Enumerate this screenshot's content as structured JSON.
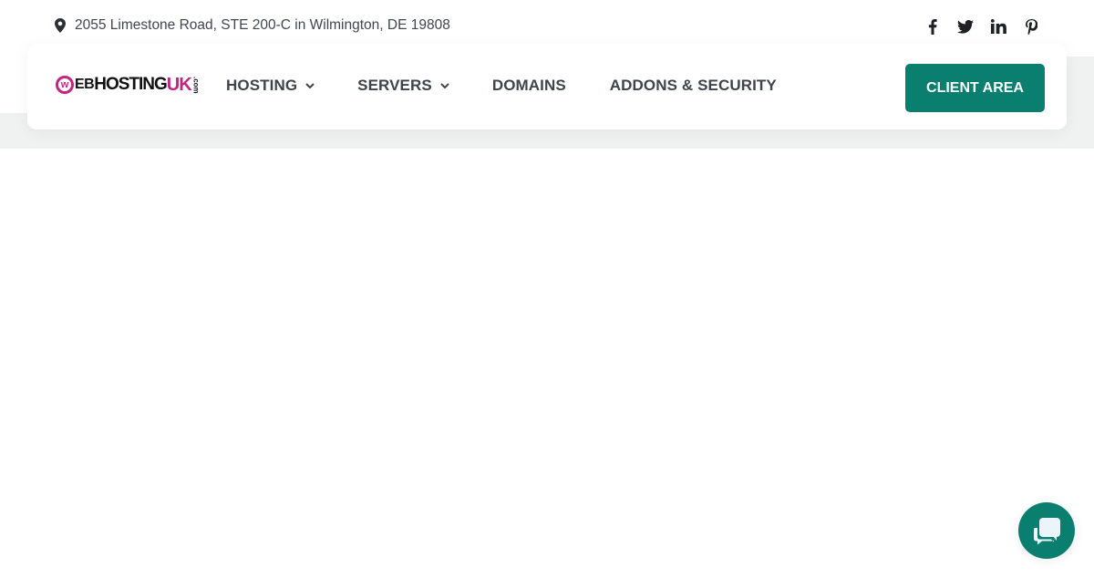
{
  "topbar": {
    "address_icon": "map-pin-icon",
    "address": "2055 Limestone Road, STE 200-C in Wilmington, DE 19808",
    "socials": [
      {
        "name": "facebook",
        "icon": "facebook-icon"
      },
      {
        "name": "twitter",
        "icon": "twitter-icon"
      },
      {
        "name": "linkedin",
        "icon": "linkedin-icon"
      },
      {
        "name": "pinterest",
        "icon": "pinterest-icon"
      }
    ]
  },
  "logo": {
    "w": "w",
    "eb": "EB",
    "hosting": "HOSTING",
    "uk": "UK",
    "com": ".com"
  },
  "nav": {
    "items": [
      {
        "label": "HOSTING",
        "has_dropdown": true
      },
      {
        "label": "SERVERS",
        "has_dropdown": true
      },
      {
        "label": "DOMAINS",
        "has_dropdown": false
      },
      {
        "label": "ADDONS & SECURITY",
        "has_dropdown": false
      }
    ],
    "cta_label": "CLIENT AREA"
  },
  "chat": {
    "icon": "chat-bubbles-icon"
  },
  "colors": {
    "brand_green": "#0a7f6f",
    "brand_magenta": "#c2267f",
    "text": "#3e444c",
    "band_gray": "#f0f1f1"
  }
}
